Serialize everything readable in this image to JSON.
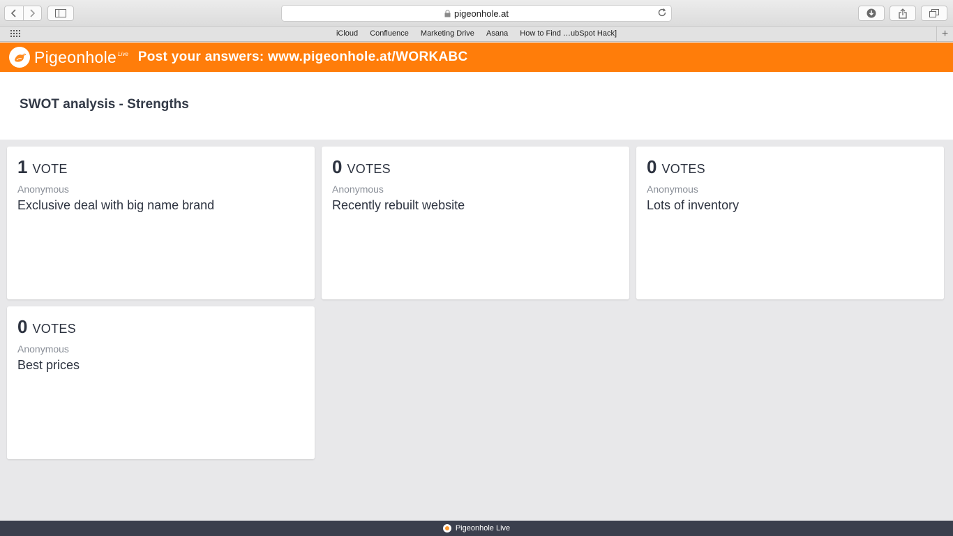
{
  "browser": {
    "url": "pigeonhole.at",
    "bookmarks": [
      "iCloud",
      "Confluence",
      "Marketing Drive",
      "Asana",
      "How to Find …ubSpot Hack]"
    ],
    "icons": {
      "back": "chevron-left-icon",
      "forward": "chevron-right-icon",
      "sidebar": "sidebar-icon",
      "lock": "lock-icon",
      "reload": "reload-icon",
      "download": "download-icon",
      "share": "share-icon",
      "tabs": "tabs-icon",
      "grid": "grid-icon",
      "new_tab": "plus-icon"
    }
  },
  "header": {
    "logo_text": "Pigeonhole",
    "logo_sup": "Live",
    "message": "Post your answers: www.pigeonhole.at/WORKABC",
    "background": "#ff7d0a"
  },
  "session": {
    "title": "SWOT analysis - Strengths"
  },
  "answers": [
    {
      "count": "1",
      "label": "VOTE",
      "author": "Anonymous",
      "text": "Exclusive deal with big name brand"
    },
    {
      "count": "0",
      "label": "VOTES",
      "author": "Anonymous",
      "text": "Recently rebuilt website"
    },
    {
      "count": "0",
      "label": "VOTES",
      "author": "Anonymous",
      "text": "Lots of inventory"
    },
    {
      "count": "0",
      "label": "VOTES",
      "author": "Anonymous",
      "text": "Best prices"
    }
  ],
  "footer": {
    "text": "Pigeonhole Live"
  }
}
